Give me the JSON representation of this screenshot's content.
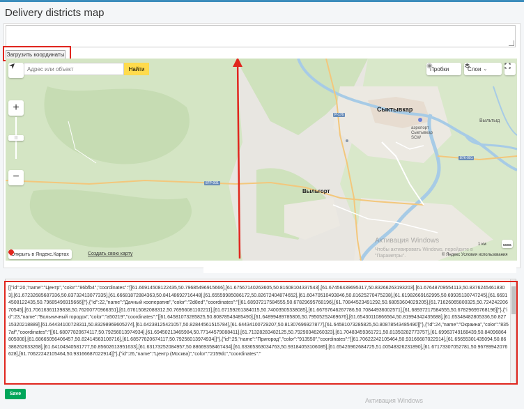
{
  "page": {
    "title": "Delivery districts map"
  },
  "controls": {
    "load_coordinates_label": "Загрузить координаты",
    "save_label": "Save"
  },
  "map": {
    "search_placeholder": "Адрес или объект",
    "find_label": "Найти",
    "traffic_label": "Пробки",
    "layers_label": "Слои",
    "zoom_in": "+",
    "zoom_out": "−",
    "open_in_yandex": "Открыть в Яндекс.Картах",
    "create_map": "Создать свою карту",
    "scale_label": "1 км",
    "copyright": "© Яндекс Условия использования",
    "labels": {
      "city_main": "Сыктывкар",
      "city_second": "Выльгорт",
      "airport_1": "аэропорт",
      "airport_2": "Сыктывкар",
      "airport_3": "SCW",
      "village_east": "Выльтыд",
      "road_p1": "Р-176",
      "road_p2": "87Р-001",
      "road_p3": "87К-001"
    }
  },
  "watermark": {
    "title": "Активация Windows",
    "line1": "Чтобы активировать Windows, перейдите в",
    "line2": "\"Параметры\".",
    "bottom": "Активация Windows"
  },
  "json_text": "[{\"id\":20,\"name\":\"Центр\",\"color\":\"86bfb4\",\"coordinates\":\"[[61.66914508122435,50.79685496915666],[61.67567140263605,50.81608104337543],[61.67456439695317,50.83266263193203],[61.67648709554113,50.83762454618303],[61.67232685687336,50.83732413077335],[61.66681872884363,50.84148692716448],[61.65559985086172,50.82672404874652],[61.60470510493846,50.81625270475238],[61.61982669162995,50.69935130747245],[61.66914508122435,50.79685496915666]]\"},{\"id\":22,\"name\":\"Дачный кооператив\",\"color\":\"2d8ed\",\"coordinates\":\"[[61.68937217584555,50.67829695768196],[61.70844523491292,50.68053604029205],[61.71626065800325,50.72424220670545],[61.70616361139838,50.76200770966351],[61.67615082088312,50.76956081102211],[61.67159261384015,50.74003505338085],[61.66767646267786,50.70844936002571],[61.68937217584555,50.67829695768196]]\"},{\"id\":23,\"name\":\"Больничный городок\",\"color\":\"a50219\",\"coordinates\":\"[[61.64581073285825,50.80878543485490],[61.64899489785806,50.79505252469676],[61.65430110866564,50.81994342435688],[61.65348482805336,50.82715320218889],[61.64434100728311,50.83298969605274],[61.64238125421057,50.82844561515784],[61.64434100729207,50.81307696927877],[61.64581073285825,50.80878543485490]]\"},{\"id\":24,\"name\":\"Окраина\",\"color\":\"8357af\",\"coordinates\":\"[[61.68077820674117,50.79256013974934],[61.69450213465984,50.77144579088411],[61.71328283482125,50.79290346260323],[61.70483459361721,50.81350282773757],[61.69963749168439,50.84096864805008],[61.68665056406457,50.82414563108716],[61.68577820674117,50.79256013974934]]\"},{\"id\":25,\"name\":\"Пригород\",\"color\":\"913550\",\"coordinates\":\"[[61.70622242105464,50.93166687022914],[61.65655301435094,50.86386262633268],[61.64104340581777,50.85602613951633],[61.63173252084957,50.88669358467434],[61.63365363034763,50.93184053106085],[61.65426962684725,51.00548326231890],[61.67173307052781,50.96789942076628],[61.70622242105464,50.93166687022914]]\"},{\"id\":26,\"name\":\"Центр (Москва)\",\"color\":\"2159dc\",\"coordinates\":\""
}
